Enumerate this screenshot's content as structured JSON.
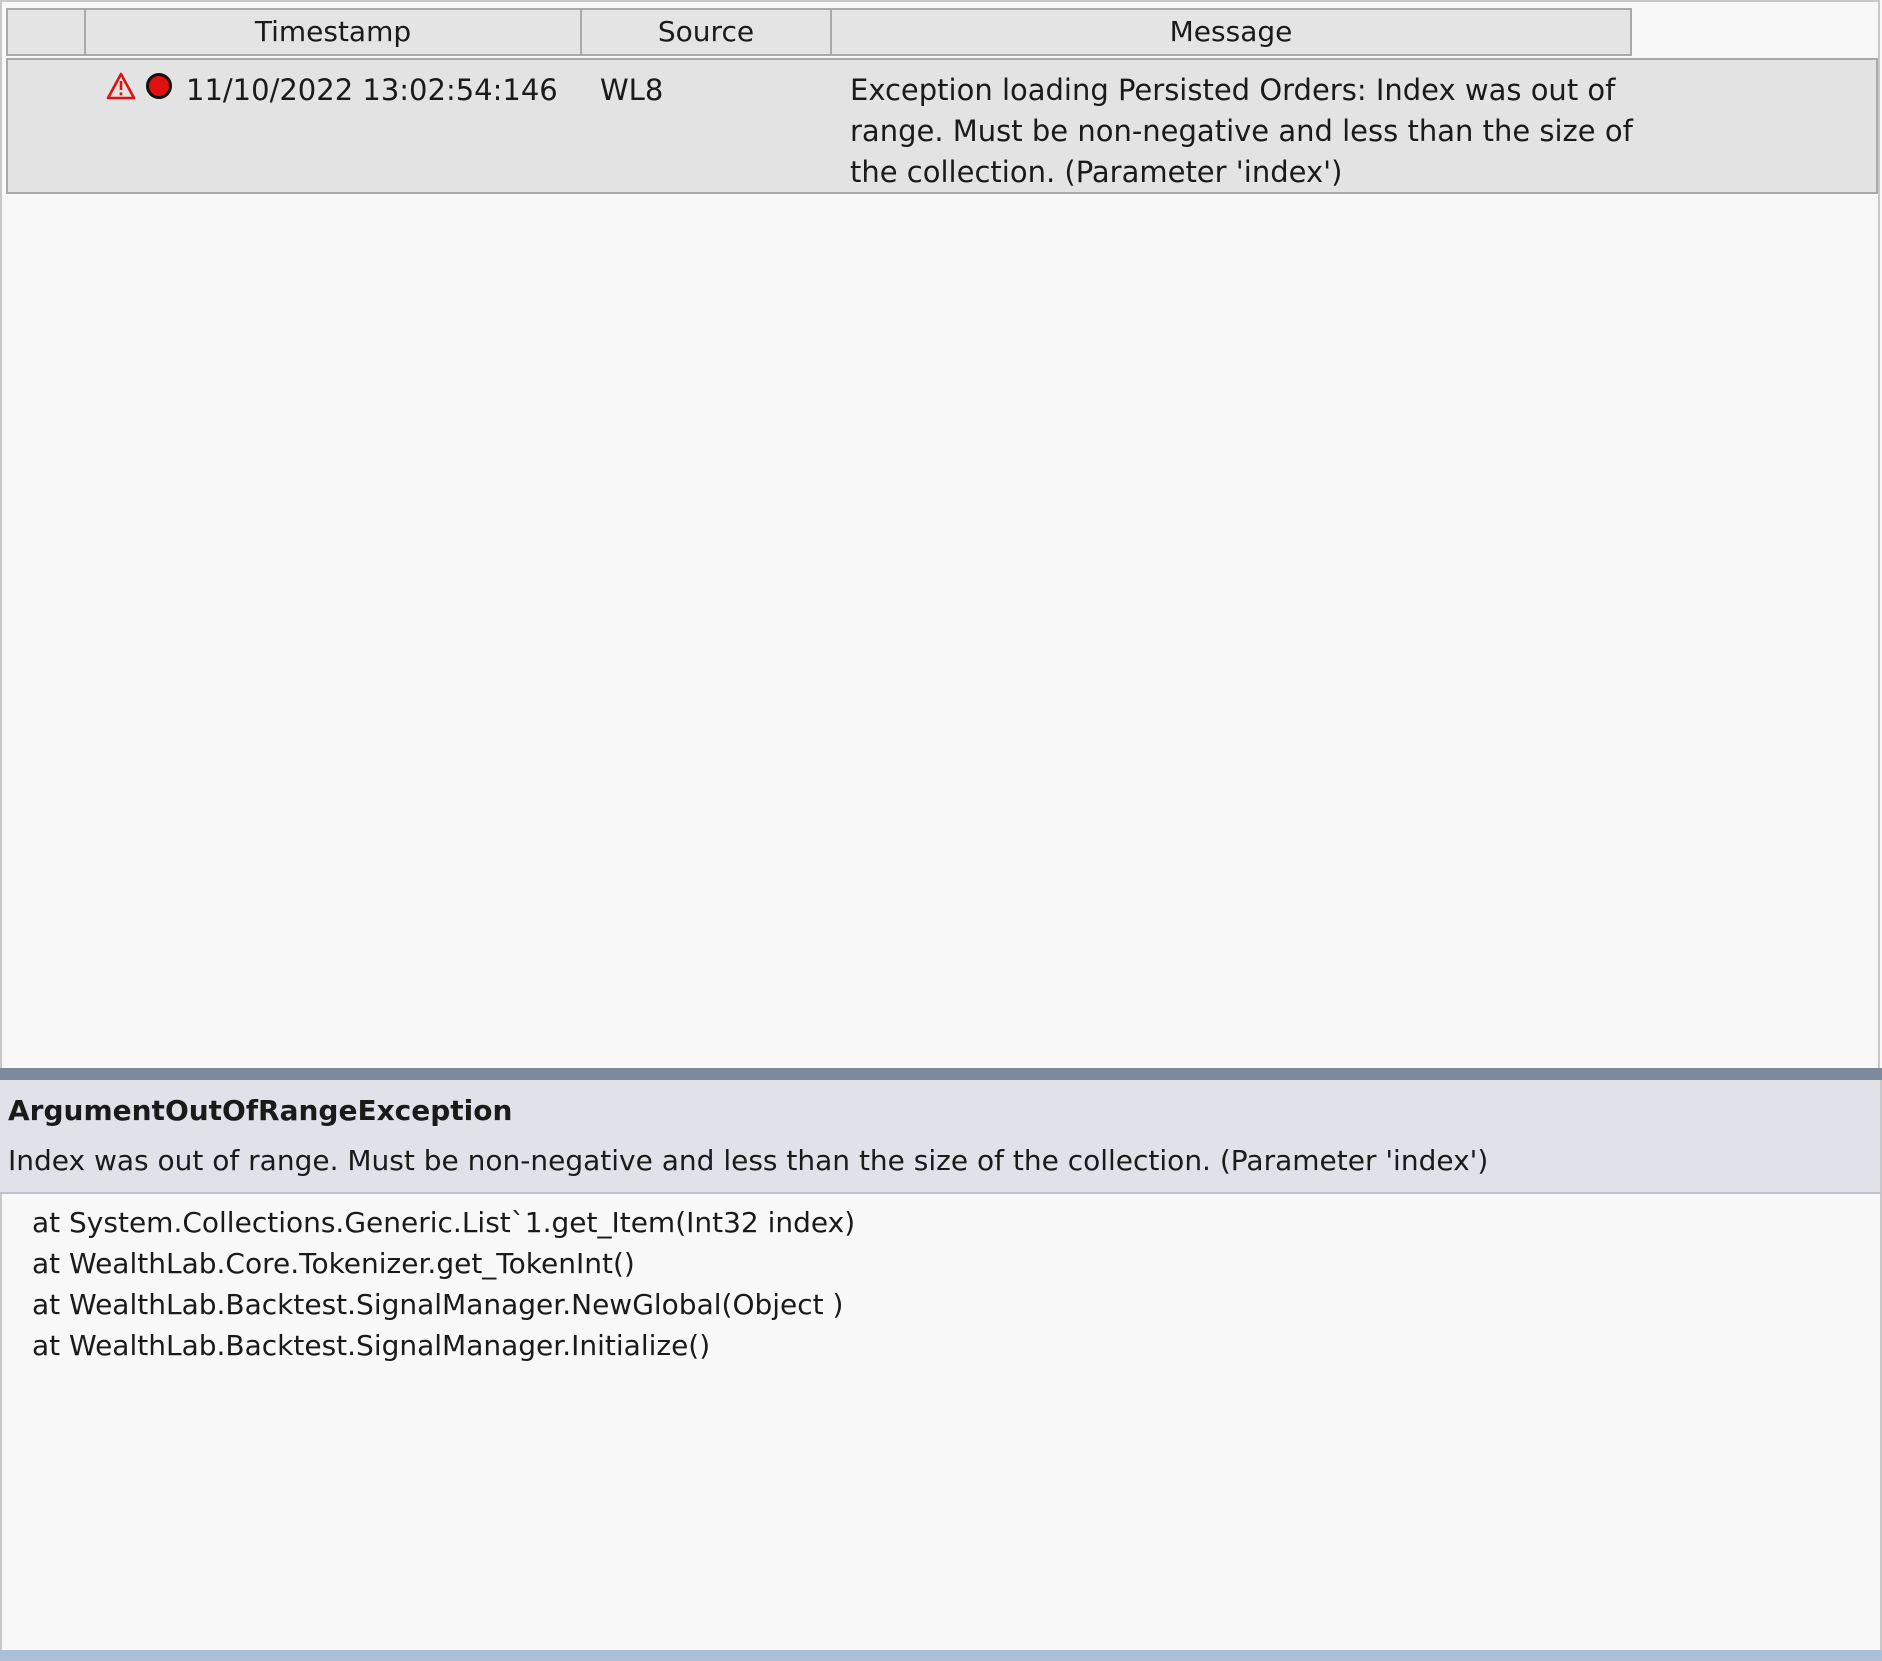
{
  "log_grid": {
    "columns": [
      "",
      "Timestamp",
      "Source",
      "Message"
    ],
    "rows": [
      {
        "severity_icon": "warning-triangle-icon",
        "status_icon": "red-dot-icon",
        "timestamp": "11/10/2022 13:02:54:146",
        "source": "WL8",
        "message": "Exception loading Persisted Orders: Index was out of range. Must be non-negative and less than the size of the collection. (Parameter 'index')"
      }
    ]
  },
  "detail": {
    "exception_type": "ArgumentOutOfRangeException",
    "exception_message": "Index was out of range. Must be non-negative and less than the size of the collection. (Parameter 'index')",
    "stack_trace": [
      "at System.Collections.Generic.List`1.get_Item(Int32 index)",
      "at WealthLab.Core.Tokenizer.get_TokenInt()",
      "at WealthLab.Backtest.SignalManager.NewGlobal(Object )",
      "at WealthLab.Backtest.SignalManager.Initialize()"
    ]
  },
  "colors": {
    "warning": "#e01010",
    "splitter": "#7c8a9c",
    "detail_header_bg": "#e1e1ea"
  }
}
